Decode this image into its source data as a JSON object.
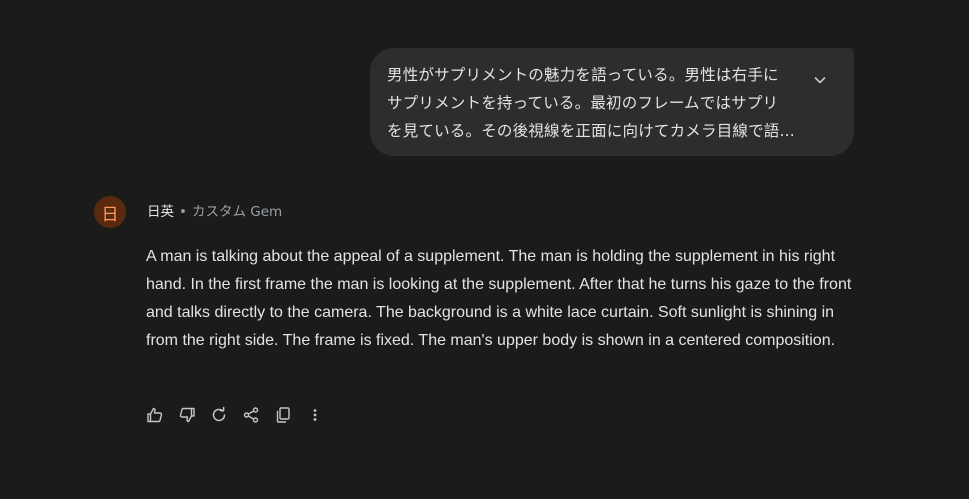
{
  "user_prompt": {
    "text": "男性がサプリメントの魅力を語っている。男性は右手に\nサプリメントを持っている。最初のフレームではサプリ\nを見ている。その後視線を正面に向けてカメラ目線で語..."
  },
  "response": {
    "avatar_letter": "日",
    "gem_name": "日英",
    "separator": "•",
    "gem_type": "カスタム Gem",
    "text": "A man is talking about the appeal of a supplement. The man is holding the supplement in his right hand. In the first frame the man is looking at the supplement. After that he turns his gaze to the front and talks directly to the camera. The background is a white lace curtain. Soft sunlight is shining in from the right side. The frame is fixed. The man's upper body is shown in a centered composition."
  },
  "actions": [
    {
      "icon": "thumbs-up-icon"
    },
    {
      "icon": "thumbs-down-icon"
    },
    {
      "icon": "redo-icon"
    },
    {
      "icon": "share-icon"
    },
    {
      "icon": "copy-icon"
    },
    {
      "icon": "more-vert-icon"
    }
  ],
  "colors": {
    "background": "#1b1b1b",
    "bubble": "#2c2d2e",
    "text": "#e3e3e3",
    "muted": "#9aa0a6",
    "avatar_bg": "#5a2a10",
    "avatar_fg": "#ff9a5c"
  }
}
